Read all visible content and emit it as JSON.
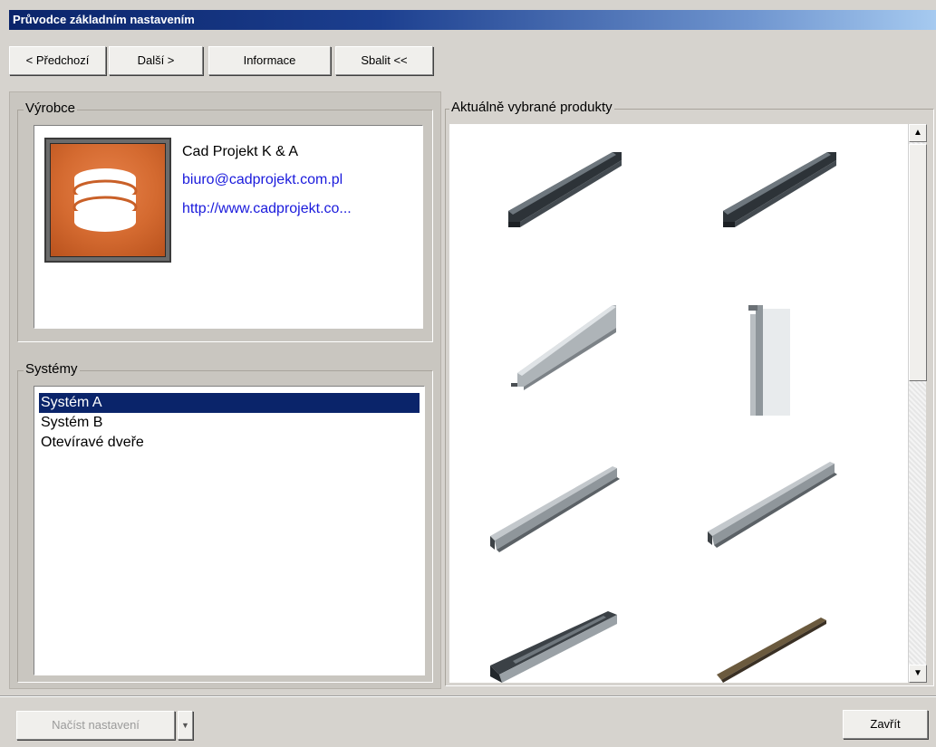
{
  "window": {
    "title": "Průvodce základním nastavením"
  },
  "toolbar": {
    "prev_label": "< Předchozí",
    "next_label": "Další >",
    "info_label": "Informace",
    "collapse_label": "Sbalit <<"
  },
  "manufacturer": {
    "legend": "Výrobce",
    "name": "Cad Projekt K & A",
    "email": "biuro@cadprojekt.com.pl",
    "website": "http://www.cadprojekt.co..."
  },
  "systems": {
    "legend": "Systémy",
    "items": [
      {
        "label": "Systém A",
        "selected": true
      },
      {
        "label": "Systém B",
        "selected": false
      },
      {
        "label": "Otevíravé dveře",
        "selected": false
      }
    ]
  },
  "products": {
    "legend": "Aktuálně vybrané produkty",
    "items": [
      {
        "kind": "dark-channel"
      },
      {
        "kind": "dark-channel"
      },
      {
        "kind": "silver-angle"
      },
      {
        "kind": "vertical-profile"
      },
      {
        "kind": "silver-rail"
      },
      {
        "kind": "silver-rail"
      },
      {
        "kind": "dark-track"
      },
      {
        "kind": "bronze-brush"
      }
    ]
  },
  "footer": {
    "load_label": "Načíst nastavení",
    "close_label": "Zavřít"
  },
  "colors": {
    "selection": "#0a246a",
    "link": "#1a1adc",
    "logo": "#d46a30"
  }
}
